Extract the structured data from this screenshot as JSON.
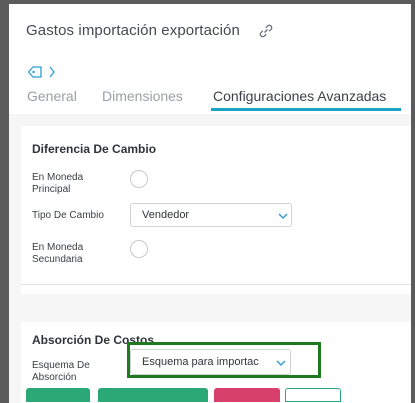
{
  "header": {
    "title": "Gastos importación exportación",
    "icons": {
      "link": "link-icon",
      "tag": "tag-icon",
      "chevron": "chevron-right-icon"
    }
  },
  "tabs": [
    {
      "label": "General",
      "active": false
    },
    {
      "label": "Dimensiones",
      "active": false
    },
    {
      "label": "Configuraciones Avanzadas",
      "active": true
    }
  ],
  "exchange_section": {
    "title": "Diferencia De Cambio",
    "local_currency_label": "En Moneda Principal",
    "rate_type_label": "Tipo De Cambio",
    "rate_type_value": "Vendedor",
    "secondary_currency_label": "En Moneda Secundaria"
  },
  "cost_section": {
    "title": "Absorción De Costos",
    "schema_label": "Esquema De Absorción",
    "schema_value": "Esquema para importac"
  },
  "colors": {
    "accent": "#1ba3c6",
    "highlight": "#1f7a1f",
    "footer_buttons": [
      "#2aa876",
      "#2aa876",
      "#d6406a",
      "#ffffff"
    ]
  }
}
